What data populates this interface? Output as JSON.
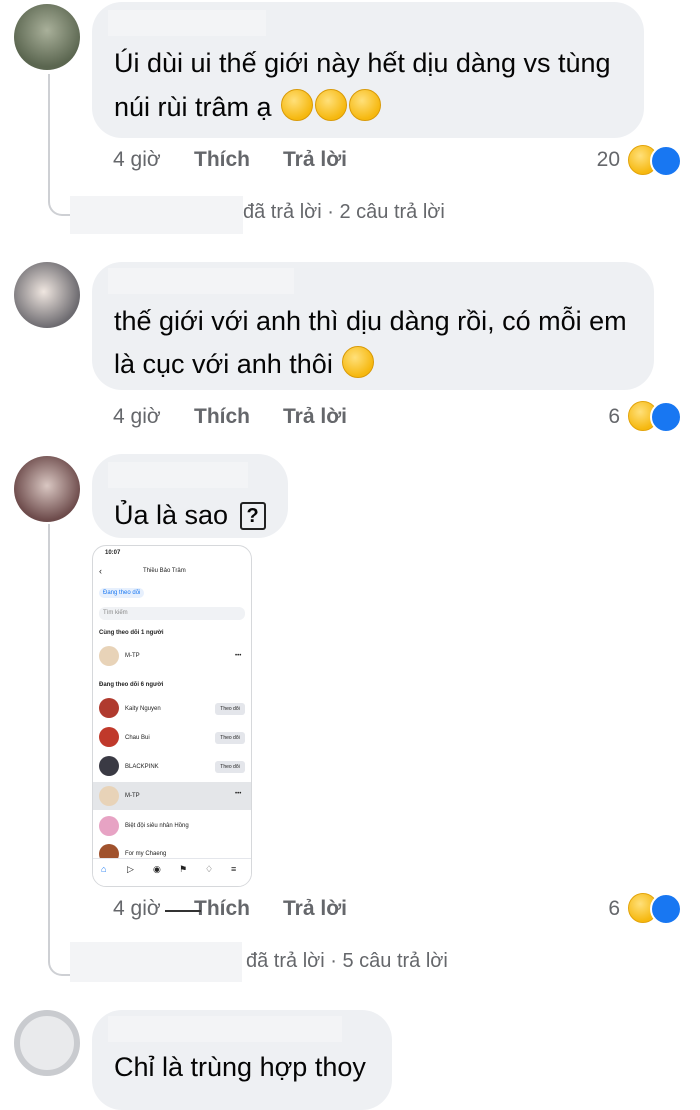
{
  "comments": [
    {
      "text_line1": "Úi dùi ui thế giới này hết dịu dàng vs tùng",
      "text_line2": "núi rùi trâm ạ",
      "time": "4 giờ",
      "like": "Thích",
      "reply": "Trả lời",
      "reaction_count": "20",
      "thread": {
        "text": "đã trả lời · 2 câu trả lời"
      }
    },
    {
      "text_line1": "thế giới với anh thì dịu dàng rồi, có mỗi em",
      "text_line2": "là cục với anh thôi",
      "time": "4 giờ",
      "like": "Thích",
      "reply": "Trả lời",
      "reaction_count": "6"
    },
    {
      "text_line1": "Ủa là sao",
      "time": "4 giờ",
      "like": "Thích",
      "reply": "Trả lời",
      "reaction_count": "6",
      "thread": {
        "text": "đã trả lời · 5 câu trả lời"
      }
    },
    {
      "text_line1": "Chỉ là trùng hợp thoy"
    }
  ],
  "screenshot": {
    "time": "10:07",
    "title": "Thiều Bảo Trâm",
    "chip": "Đang theo dõi",
    "search_placeholder": "Tìm kiếm",
    "section1": "Cùng theo dõi 1 người",
    "section2": "Đang theo dõi 6 người",
    "follow_label": "Theo dõi",
    "more": "•••",
    "people": [
      {
        "name": "M-TP",
        "color": "#e8d3b8"
      },
      {
        "name": "Kaity Nguyen",
        "color": "#b03a2e"
      },
      {
        "name": "Chau Bui",
        "color": "#c0392b"
      },
      {
        "name": "BLACKPINK",
        "color": "#3a3a44"
      },
      {
        "name": "M-TP",
        "color": "#e8d3b8"
      },
      {
        "name": "Biệt đội siêu nhân Hồng",
        "color": "#e7a3c4"
      },
      {
        "name": "For my Chaeng",
        "color": "#a0522d"
      }
    ]
  },
  "colors": {
    "bubble": "#eef0f3",
    "meta": "#65676b",
    "like_blue": "#1877f2",
    "haha": "#f6b80f"
  }
}
